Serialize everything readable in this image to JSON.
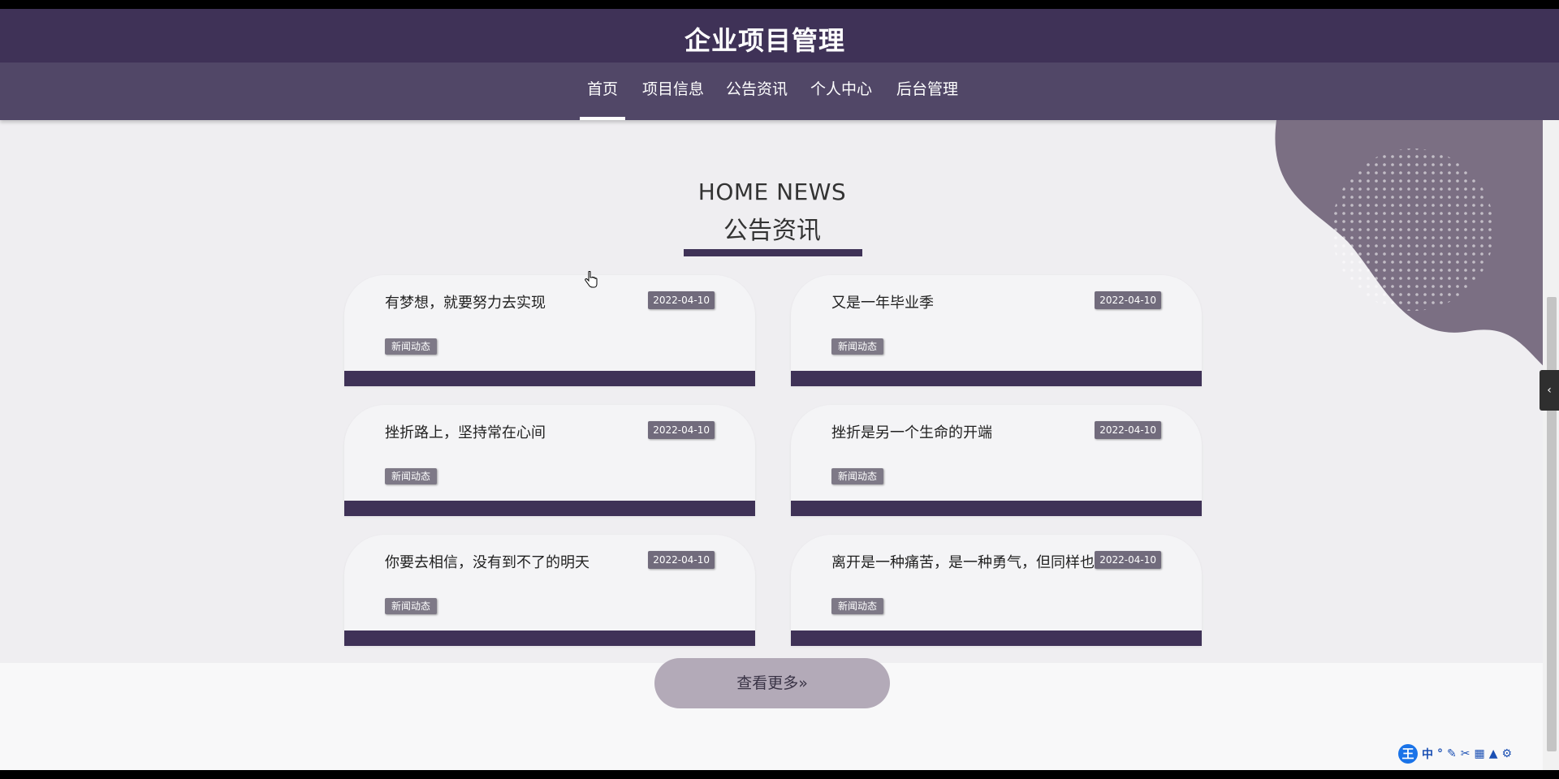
{
  "header": {
    "title": "企业项目管理"
  },
  "nav": {
    "items": [
      {
        "label": "首页",
        "active": true
      },
      {
        "label": "项目信息",
        "active": false
      },
      {
        "label": "公告资讯",
        "active": false
      },
      {
        "label": "个人中心",
        "active": false
      },
      {
        "label": "后台管理",
        "active": false
      }
    ]
  },
  "section": {
    "title_en": "HOME NEWS",
    "title_zh": "公告资讯"
  },
  "news": [
    {
      "title": "有梦想，就要努力去实现",
      "date": "2022-04-10",
      "tag": "新闻动态"
    },
    {
      "title": "又是一年毕业季",
      "date": "2022-04-10",
      "tag": "新闻动态"
    },
    {
      "title": "挫折路上，坚持常在心间",
      "date": "2022-04-10",
      "tag": "新闻动态"
    },
    {
      "title": "挫折是另一个生命的开端",
      "date": "2022-04-10",
      "tag": "新闻动态"
    },
    {
      "title": "你要去相信，没有到不了的明天",
      "date": "2022-04-10",
      "tag": "新闻动态"
    },
    {
      "title": "离开是一种痛苦，是一种勇气，但同样也是一种保护",
      "date": "2022-04-10",
      "tag": "新闻动态"
    }
  ],
  "more_button": {
    "label": "查看更多»"
  },
  "ime_toolbar": {
    "logo": "王",
    "mode": "中",
    "icons": [
      "punctuation-icon",
      "pen-icon",
      "scissors-icon",
      "keyboard-icon",
      "shirt-icon",
      "settings-icon"
    ]
  },
  "colors": {
    "primary": "#3f3257",
    "nav": "#514767",
    "card_bg": "#f4f4f6",
    "date_badge": "#716b7c",
    "button": "#b3aab8"
  }
}
